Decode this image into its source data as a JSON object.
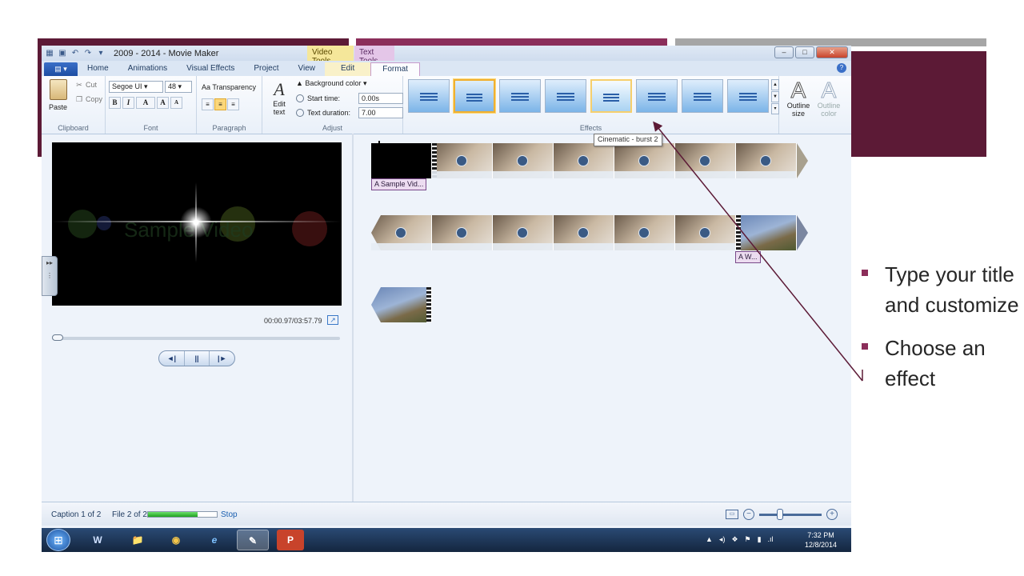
{
  "slide": {
    "bullets": [
      "Type your title and customize",
      "Choose an effect"
    ],
    "colors": {
      "maroon": "#5c1a36",
      "plum": "#8b2e5a",
      "grey": "#a6a6a6"
    }
  },
  "window": {
    "title": "2009 - 2014 - Movie Maker",
    "context_tabs": {
      "video_tools": "Video Tools",
      "text_tools": "Text Tools"
    }
  },
  "tabs": [
    "Home",
    "Animations",
    "Visual Effects",
    "Project",
    "View",
    "Edit",
    "Format"
  ],
  "active_tab": "Format",
  "ribbon": {
    "clipboard": {
      "label": "Clipboard",
      "paste": "Paste",
      "cut": "Cut",
      "copy": "Copy"
    },
    "font": {
      "label": "Font",
      "family": "Segoe UI",
      "size": "48",
      "bold": "B",
      "italic": "I",
      "color": "A",
      "grow": "A",
      "shrink": "A"
    },
    "paragraph": {
      "label": "Paragraph",
      "transparency": "Transparency"
    },
    "adjust": {
      "label": "Adjust",
      "edit_text": "Edit text",
      "background_color": "Background color",
      "start_time_label": "Start time:",
      "start_time_value": "0.00s",
      "text_duration_label": "Text duration:",
      "text_duration_value": "7.00"
    },
    "effects": {
      "label": "Effects",
      "count": 8,
      "selected_index": 1,
      "hover_index": 4,
      "tooltip": "Cinematic - burst 2"
    },
    "outline": {
      "size": "Outline size",
      "color": "Outline color"
    }
  },
  "preview": {
    "overlay_text": "Sample Video",
    "time": "00:00.97/03:57.79",
    "seek_fraction": 0.0,
    "controls": [
      "◄|",
      "||",
      "|►"
    ]
  },
  "storyboard": {
    "caption_1": "Sample Vid...",
    "caption_2": "W..."
  },
  "statusbar": {
    "caption": "Caption 1 of 2",
    "file": "File 2 of 2",
    "progress": 0.72,
    "stop": "Stop"
  },
  "taskbar": {
    "apps": [
      "W",
      "📁",
      "◉",
      "e",
      "✎",
      "P"
    ],
    "time": "7:32 PM",
    "date": "12/8/2014"
  }
}
